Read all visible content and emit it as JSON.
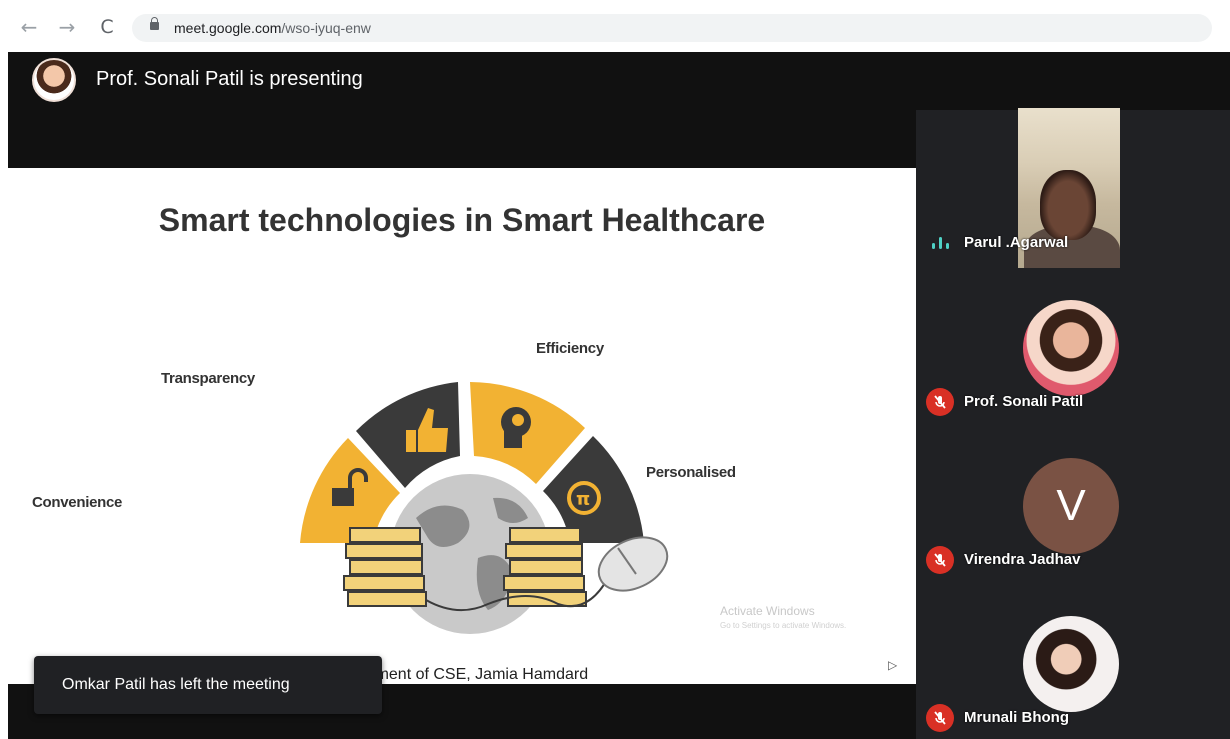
{
  "browser": {
    "url_host": "meet.google.com",
    "url_path": "/wso-iyuq-enw",
    "back_icon": "←",
    "forward_icon": "→",
    "reload_icon": "C"
  },
  "presenting": {
    "text": "Prof. Sonali Patil is presenting"
  },
  "slide": {
    "title": "Smart technologies  in Smart Healthcare",
    "labels": {
      "transparency": "Transparency",
      "efficiency": "Efficiency",
      "convenience": "Convenience",
      "personalised": "Personalised"
    },
    "footer": "partment of CSE, Jamia Hamdard",
    "watermark_line1": "Activate Windows",
    "watermark_line2": "Go to Settings to activate Windows."
  },
  "toast": {
    "text": "Omkar Patil has left the meeting"
  },
  "participants": [
    {
      "name": "Parul .Agarwal",
      "state": "speaking"
    },
    {
      "name": "Prof. Sonali Patil",
      "state": "muted"
    },
    {
      "name": "Virendra Jadhav",
      "state": "muted",
      "initial": "V"
    },
    {
      "name": "Mrunali Bhong",
      "state": "muted"
    }
  ],
  "colors": {
    "meet_bg": "#202124",
    "bar_black": "#111111",
    "mute_red": "#d93025",
    "speaking_teal": "#4fd1c5",
    "slide_yellow": "#f2b233",
    "slide_dark": "#3a3a3a"
  }
}
